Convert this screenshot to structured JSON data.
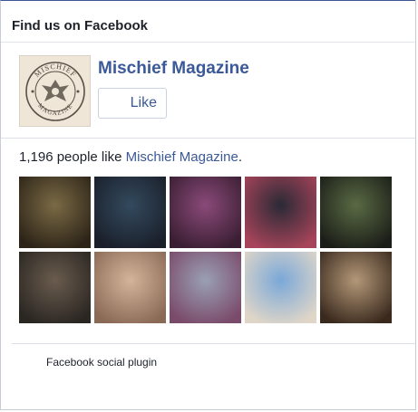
{
  "widget": {
    "title": "Find us on Facebook",
    "page_name": "Mischief Magazine",
    "like_label": "Like",
    "like_count_prefix": "1,196 people like ",
    "like_count_link": "Mischief Magazine",
    "like_count_suffix": ".",
    "footer": "Facebook social plugin",
    "logo_text_top": "MISCHIEF",
    "logo_text_bottom": "MAGAZINE"
  },
  "faces": [
    {
      "name": "fan-face-1",
      "colors": [
        "#7a6a45",
        "#2d2418"
      ]
    },
    {
      "name": "fan-face-2",
      "colors": [
        "#334a5e",
        "#1a1f2a"
      ]
    },
    {
      "name": "fan-face-3",
      "colors": [
        "#8a4a7a",
        "#3a1e32"
      ]
    },
    {
      "name": "fan-face-4",
      "colors": [
        "#2a2a36",
        "#a8445a"
      ]
    },
    {
      "name": "fan-face-5",
      "colors": [
        "#5a6a44",
        "#1b1e18"
      ]
    },
    {
      "name": "fan-face-6",
      "colors": [
        "#6a5c4e",
        "#2a2622"
      ]
    },
    {
      "name": "fan-face-7",
      "colors": [
        "#d4b49a",
        "#8a6a55"
      ]
    },
    {
      "name": "fan-face-8",
      "colors": [
        "#9aa0b4",
        "#7a4a6a"
      ]
    },
    {
      "name": "fan-face-9",
      "colors": [
        "#7aa8d8",
        "#e0d6c8"
      ]
    },
    {
      "name": "fan-face-10",
      "colors": [
        "#b49878",
        "#3a2a1e"
      ]
    }
  ],
  "colors": {
    "brand": "#3b5998",
    "border": "#c7cdd6"
  }
}
